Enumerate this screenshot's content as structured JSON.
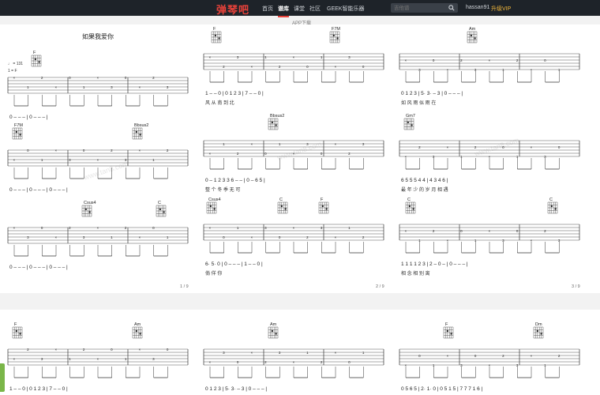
{
  "header": {
    "logo": "弹琴吧",
    "nav": [
      {
        "label": "首页",
        "active": false
      },
      {
        "label": "谱库",
        "active": true
      },
      {
        "label": "课堂",
        "active": false
      },
      {
        "label": "社区",
        "active": false
      },
      {
        "label": "GEEK智能乐器",
        "active": false
      }
    ],
    "search_placeholder": "吉他谱",
    "username": "hassan91",
    "vip_label": "升级VIP"
  },
  "app_download": "APP下载",
  "sheet": {
    "title": "如果我爱你",
    "tempo": "♩ = 131",
    "key": "1 = F",
    "page_numbers": [
      "1 / 9",
      "2 / 9",
      "3 / 9"
    ],
    "watermark": "www.tan8.com",
    "systems": [
      {
        "chords": [
          "F"
        ],
        "numbers": "0  –  –  –  |  0  –  –  –  |",
        "lyrics": ""
      },
      {
        "chords": [
          "F",
          "F7M"
        ],
        "numbers": "1  –  –  0  |  0  1  2  3  |  7  –  –  0  |",
        "lyrics": "风        从  南  到  北"
      },
      {
        "chords": [
          "Am"
        ],
        "numbers": "0  1  2  3  |  5·  3·  –  3  |  0  –  –  –  |",
        "lyrics": "如  风  雨  似  雨              在"
      },
      {
        "chords": [
          "F7M",
          "Bbsus2"
        ],
        "numbers": "0  –  –  –  |  0  –  –  –  |  0  –  –  –  |",
        "lyrics": ""
      },
      {
        "chords": [
          "Bbsus2"
        ],
        "numbers": "0  –  1  2 3  3  6  –  –  |  0  –  6  5  |",
        "lyrics": "整  个 冬    季              无  可"
      },
      {
        "chords": [
          "Gm7"
        ],
        "numbers": "6  5  5 5 4 4  |  4  3  4  6  |",
        "lyrics": "最  年  少    的      岁  月  相  遇"
      },
      {
        "chords": [
          "Csus4",
          "C"
        ],
        "numbers": "0  –  –  –  |  0  –  –  –  |  0  –  –  –  |",
        "lyrics": ""
      },
      {
        "chords": [
          "Csus4",
          "C",
          "F"
        ],
        "numbers": "6·  5·  0  |  0  –  –  –  |  1  –  –  0  |",
        "lyrics": "倘  佯              你"
      },
      {
        "chords": [
          "C",
          "C"
        ],
        "numbers": "1  1 1 1 2 3  |  2  –  0  –  |  0  –  –  –  |",
        "lyrics": "相  念  相    别          离"
      },
      {
        "chords": [
          "F",
          "Am"
        ],
        "numbers": "1  –  –  0  |  0  1  2  3  |  7  –  –  0  |",
        "lyrics": ""
      },
      {
        "chords": [
          "Am"
        ],
        "numbers": "0  1  2  3  |  5·  3·  –  3  |  0  –  –  –  |",
        "lyrics": ""
      },
      {
        "chords": [
          "F",
          "Dm"
        ],
        "numbers": "0 5 6 5  |  2·  1·  0  |  0 5 1 5  |  7 7 7 1 6  |",
        "lyrics": ""
      }
    ]
  },
  "colors": {
    "topbar": "#1e2329",
    "brand": "#e9423a",
    "vip": "#f3b83c",
    "staff": "#444444"
  }
}
